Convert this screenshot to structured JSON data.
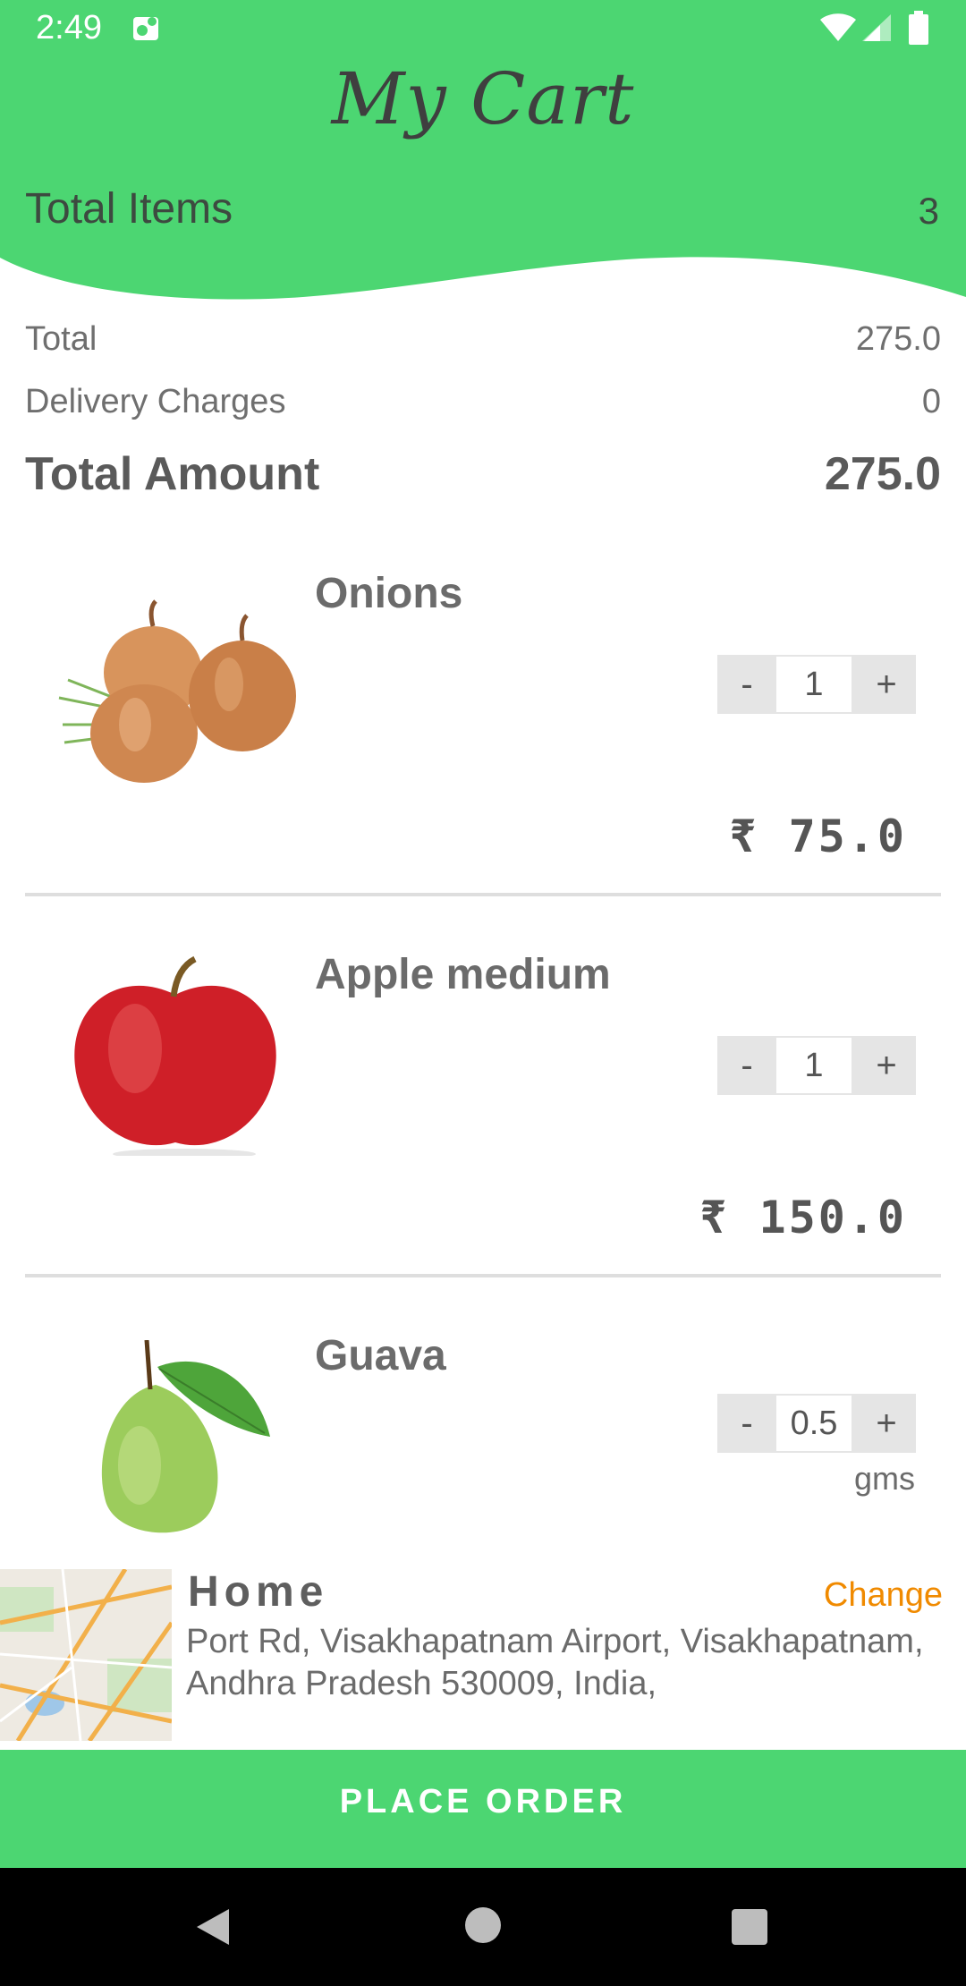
{
  "status_bar": {
    "time": "2:49"
  },
  "header": {
    "title": "My Cart",
    "total_items_label": "Total Items",
    "total_items_value": "3"
  },
  "summary": {
    "total_label": "Total",
    "total_value": "275.0",
    "delivery_label": "Delivery Charges",
    "delivery_value": "0",
    "amount_label": "Total Amount",
    "amount_value": "275.0"
  },
  "items": [
    {
      "name": "Onions",
      "minus": "-",
      "qty": "1",
      "plus": "+",
      "price": "₹ 75.0"
    },
    {
      "name": "Apple medium",
      "minus": "-",
      "qty": "1",
      "plus": "+",
      "price": "₹ 150.0"
    },
    {
      "name": "Guava",
      "minus": "-",
      "qty": "0.5",
      "plus": "+",
      "unit": "gms"
    }
  ],
  "address": {
    "title": "Home",
    "change": "Change",
    "text": "Port Rd, Visakhapatnam Airport, Visakhapatnam, Andhra Pradesh 530009, India,"
  },
  "place_order": "PLACE ORDER",
  "colors": {
    "accent": "#4cd672",
    "change": "#f08a00"
  }
}
